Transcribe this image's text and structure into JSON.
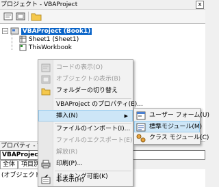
{
  "project_window": {
    "title": "プロジェクト - VBAProject",
    "close_glyph": "x",
    "tree": {
      "root": "VBAProject (Book1)",
      "sheet": "Sheet1 (Sheet1)",
      "workbook": "ThisWorkbook"
    }
  },
  "properties_window": {
    "title": "プロパティ - VBAProject",
    "object_combo": "VBAProject V",
    "tabs": [
      "全体",
      "項目別"
    ],
    "row_name": "(オブジェクト名)"
  },
  "context_menu": {
    "items": [
      {
        "label": "コードの表示(O)",
        "enabled": false,
        "icon": "code-view-icon"
      },
      {
        "label": "オブジェクトの表示(B)",
        "enabled": false,
        "icon": "object-view-icon"
      },
      {
        "label": "フォルダーの切り替え",
        "enabled": true,
        "icon": "folder-icon"
      },
      {
        "label": "VBAProject のプロパティ(E)...",
        "enabled": true
      },
      {
        "label": "挿入(N)",
        "enabled": true,
        "has_submenu": true
      },
      {
        "label": "ファイルのインポート(I)...",
        "enabled": true
      },
      {
        "label": "ファイルのエクスポート(E)...",
        "enabled": false
      },
      {
        "label": "解放(R)",
        "enabled": false
      },
      {
        "label": "印刷(P)...",
        "enabled": true,
        "icon": "print-icon"
      },
      {
        "label": "ドッキング可能(K)",
        "enabled": true,
        "checked": true
      },
      {
        "label": "非表示(H)",
        "enabled": true,
        "icon": "hide-icon"
      }
    ]
  },
  "insert_submenu": {
    "items": [
      {
        "label": "ユーザー フォーム(U)",
        "icon": "userform-icon"
      },
      {
        "label": "標準モジュール(M)",
        "icon": "module-icon",
        "highlighted": true
      },
      {
        "label": "クラス モジュール(C)",
        "icon": "class-module-icon"
      }
    ]
  }
}
